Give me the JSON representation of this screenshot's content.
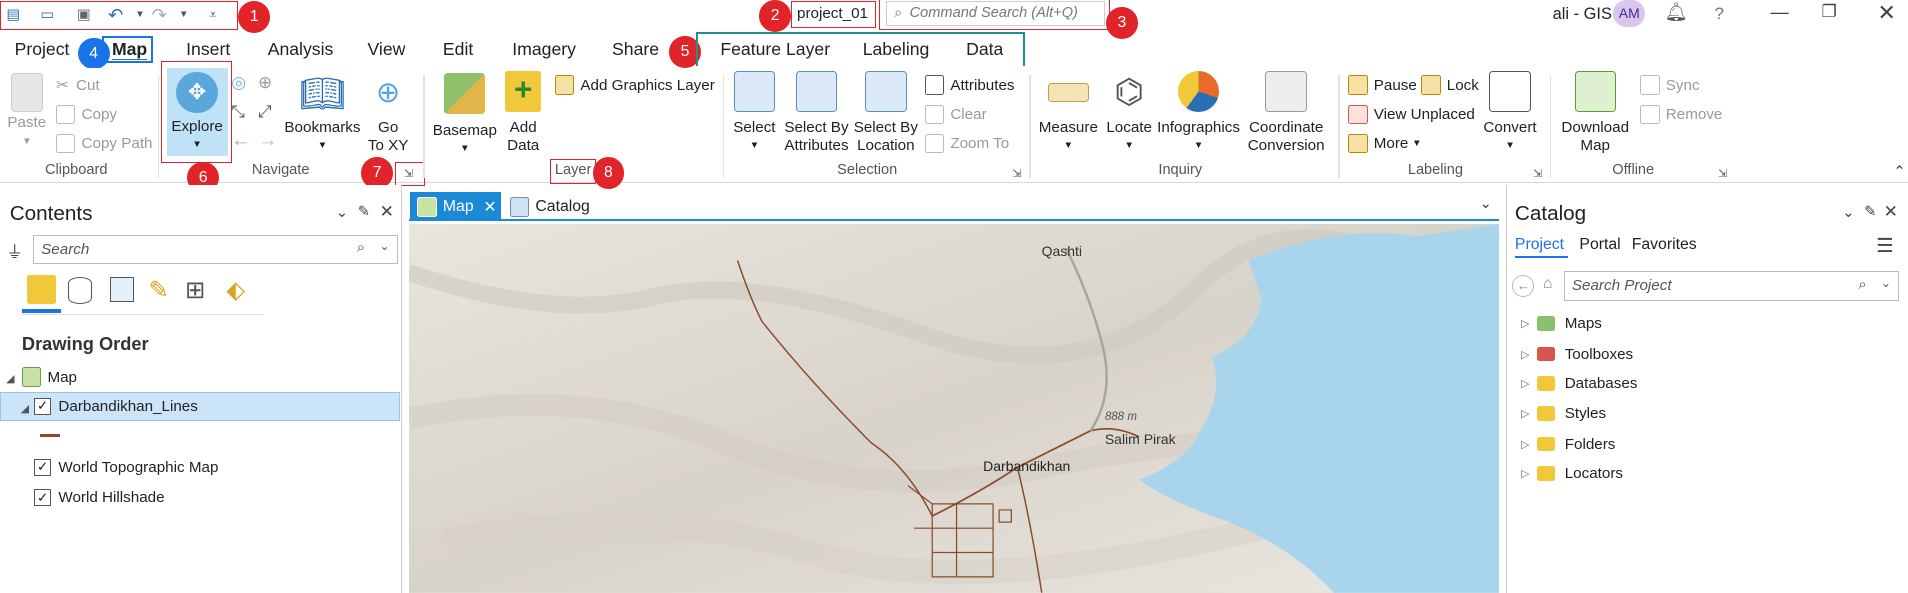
{
  "titlebar": {
    "project_name": "project_01",
    "command_search_placeholder": "Command Search (Alt+Q)",
    "user_label": "ali - GIS",
    "avatar_initials": "AM",
    "help": "?"
  },
  "badges": {
    "b1": "1",
    "b2": "2",
    "b3": "3",
    "b4": "4",
    "b5": "5",
    "b6": "6",
    "b7": "7",
    "b8": "8"
  },
  "tabs": {
    "project": "Project",
    "map": "Map",
    "insert": "Insert",
    "analysis": "Analysis",
    "view": "View",
    "edit": "Edit",
    "imagery": "Imagery",
    "share": "Share",
    "feature_layer": "Feature Layer",
    "labeling": "Labeling",
    "data": "Data"
  },
  "ribbon": {
    "clipboard": {
      "paste": "Paste",
      "cut": "Cut",
      "copy": "Copy",
      "copy_path": "Copy Path",
      "group": "Clipboard"
    },
    "navigate": {
      "explore": "Explore",
      "bookmarks": "Bookmarks",
      "go_to_xy_1": "Go",
      "go_to_xy_2": "To XY",
      "group": "Navigate"
    },
    "layer": {
      "basemap": "Basemap",
      "add_data_1": "Add",
      "add_data_2": "Data",
      "add_graphics": "Add Graphics Layer",
      "group": "Layer"
    },
    "selection": {
      "select": "Select",
      "by_attr_1": "Select By",
      "by_attr_2": "Attributes",
      "by_loc_1": "Select By",
      "by_loc_2": "Location",
      "attributes": "Attributes",
      "clear": "Clear",
      "zoom_to": "Zoom To",
      "group": "Selection"
    },
    "inquiry": {
      "measure": "Measure",
      "locate": "Locate",
      "infographics": "Infographics",
      "coord_1": "Coordinate",
      "coord_2": "Conversion",
      "group": "Inquiry"
    },
    "labeling": {
      "pause": "Pause",
      "lock": "Lock",
      "view_unplaced": "View Unplaced",
      "more": "More",
      "convert": "Convert",
      "group": "Labeling"
    },
    "offline": {
      "download_1": "Download",
      "download_2": "Map",
      "sync": "Sync",
      "remove": "Remove",
      "group": "Offline"
    }
  },
  "contents": {
    "title": "Contents",
    "search_placeholder": "Search",
    "drawing_order": "Drawing Order",
    "layers": [
      "Map",
      "Darbandikhan_Lines",
      "World Topographic Map",
      "World Hillshade"
    ]
  },
  "view_tabs": {
    "map": "Map",
    "catalog": "Catalog"
  },
  "map_labels": {
    "qashti": "Qashti",
    "elev": "888 m",
    "salim_pirak": "Salim Pirak",
    "darbandikhan": "Darbandikhan"
  },
  "catalog": {
    "title": "Catalog",
    "tabs": [
      "Project",
      "Portal",
      "Favorites"
    ],
    "search_placeholder": "Search Project",
    "items": [
      "Maps",
      "Toolboxes",
      "Databases",
      "Styles",
      "Folders",
      "Locators"
    ]
  },
  "colors": {
    "accent": "#1a73e8",
    "annotation_red": "#e0242a",
    "water": "#a8d4ec",
    "road": "#8a4a2a"
  }
}
